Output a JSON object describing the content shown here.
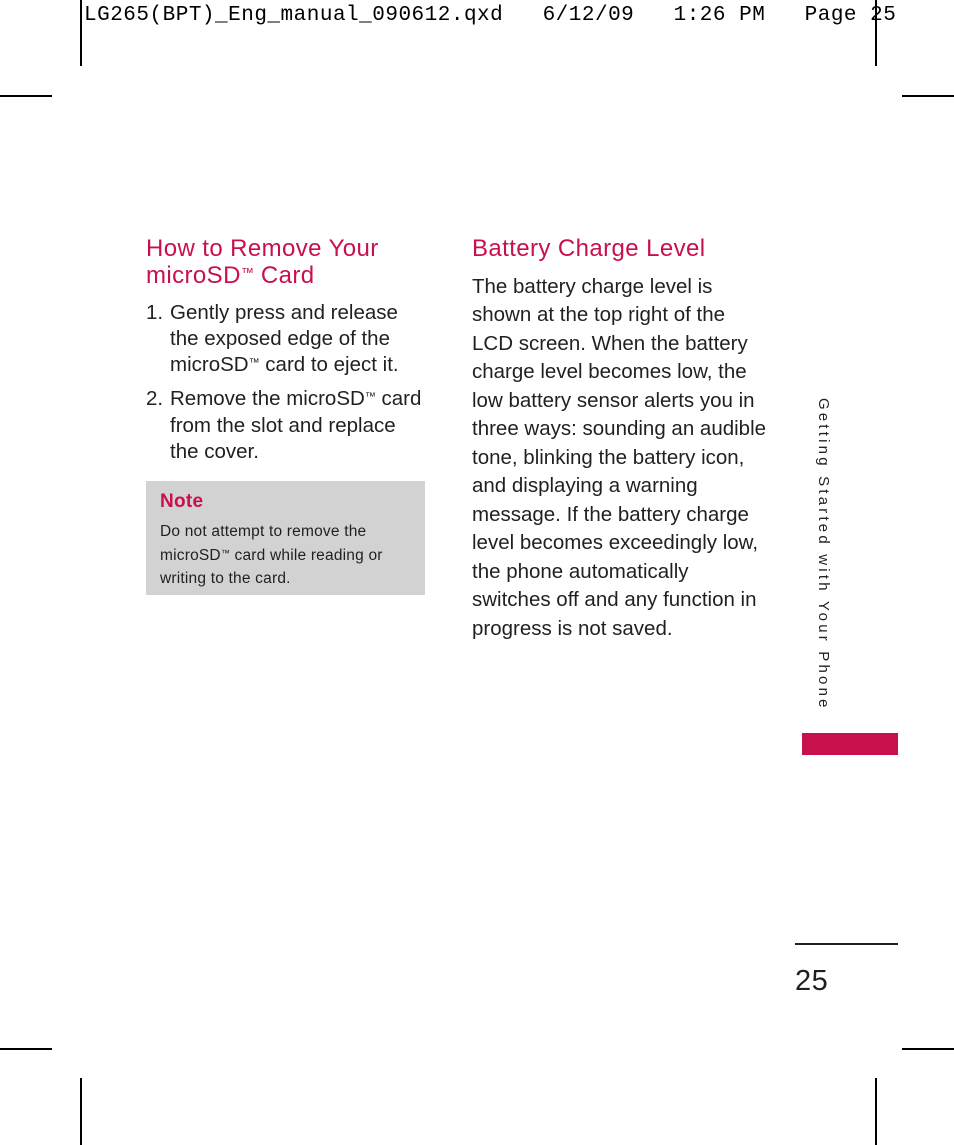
{
  "print_header": "LG265(BPT)_Eng_manual_090612.qxd   6/12/09   1:26 PM   Page 25",
  "colors": {
    "accent": "#c8104c",
    "body_text": "#231f20",
    "note_background": "#d2d2d2"
  },
  "left_column": {
    "heading_line1": "How to Remove Your",
    "heading_line2_pre": "microSD",
    "heading_tm": "™",
    "heading_line2_post": " Card",
    "steps": [
      {
        "number": "1.",
        "text_pre": "Gently press and release the exposed edge of the microSD",
        "tm": "™",
        "text_post": " card to eject it."
      },
      {
        "number": "2.",
        "text_pre": "Remove the microSD",
        "tm": "™",
        "text_post": " card from the slot and replace the cover."
      }
    ],
    "note": {
      "title": "Note",
      "text_pre": "Do not attempt to remove the microSD",
      "tm": "™",
      "text_post": " card while reading or writing to the card."
    }
  },
  "right_column": {
    "heading": "Battery Charge Level",
    "body": "The battery charge level is shown at the top right of the LCD screen. When the battery charge level becomes low, the low battery sensor alerts you in three ways: sounding an audible tone, blinking the battery icon, and displaying a warning message. If the battery charge level becomes exceedingly low, the phone automatically switches off and any function in progress is not saved."
  },
  "side_tab": {
    "running_head": "Getting Started with Your Phone"
  },
  "folio": {
    "page_number": "25"
  }
}
